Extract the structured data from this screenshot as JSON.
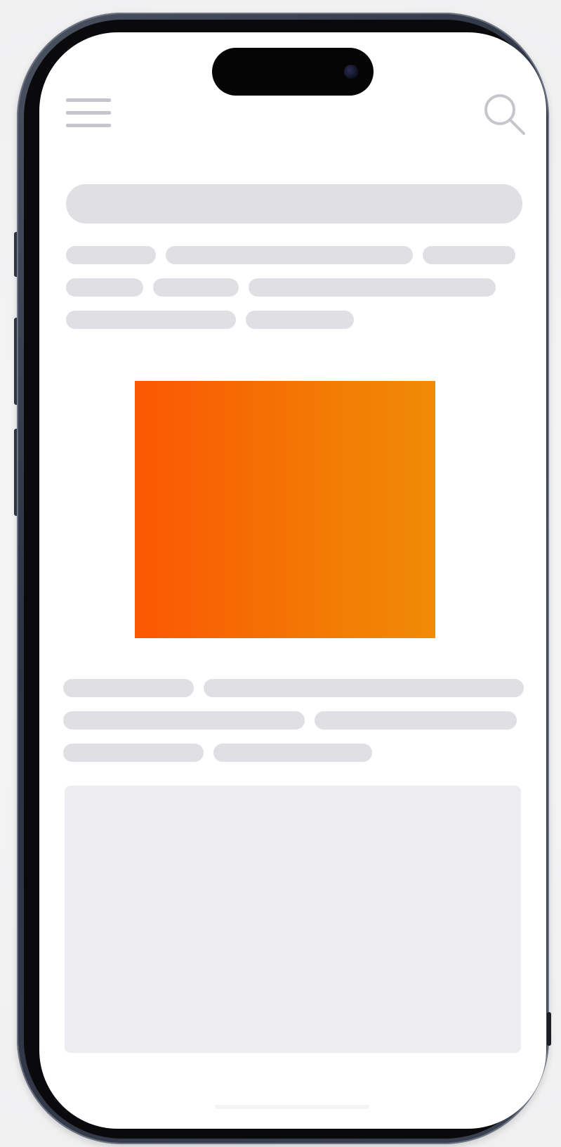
{
  "device": {
    "type": "smartphone",
    "frame_color": "#2f3543",
    "screen_color": "#ffffff"
  },
  "header": {
    "menu_icon": "hamburger-menu-icon",
    "search_icon": "magnifying-glass-icon",
    "icon_color": "#c5c5cc"
  },
  "content": {
    "state": "loading-skeleton",
    "skeleton_color": "#dfdfe4",
    "hero_image": {
      "gradient_start": "#fc5703",
      "gradient_end": "#f28a06"
    },
    "block_color": "#ededf1"
  }
}
